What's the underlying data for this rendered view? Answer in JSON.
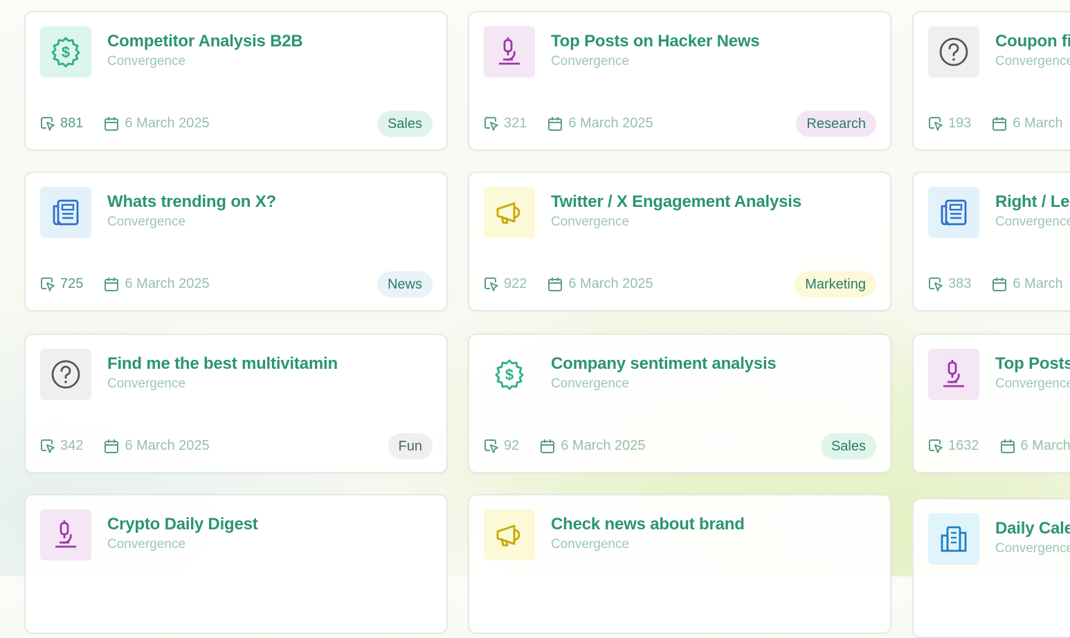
{
  "cards": [
    {
      "title": "Competitor Analysis B2B",
      "subtitle": "Convergence",
      "count": "881",
      "date": "6 March 2025",
      "tag": "Sales",
      "icon": "dollar-icon"
    },
    {
      "title": "Top Posts on Hacker News",
      "subtitle": "Convergence",
      "count": "321",
      "date": "6 March 2025",
      "tag": "Research",
      "icon": "microscope-icon"
    },
    {
      "title": "Coupon fi",
      "subtitle": "Convergence",
      "count": "193",
      "date": "6 March",
      "icon": "question-icon"
    },
    {
      "title": "Whats trending on X?",
      "subtitle": "Convergence",
      "count": "725",
      "date": "6 March 2025",
      "tag": "News",
      "icon": "newspaper-icon"
    },
    {
      "title": "Twitter / X Engagement Analysis",
      "subtitle": "Convergence",
      "count": "922",
      "date": "6 March 2025",
      "tag": "Marketing",
      "icon": "megaphone-icon"
    },
    {
      "title": "Right / Le",
      "subtitle": "Convergence",
      "count": "383",
      "date": "6 March",
      "icon": "newspaper-icon"
    },
    {
      "title": "Find me the best multivitamin",
      "subtitle": "Convergence",
      "count": "342",
      "date": "6 March 2025",
      "tag": "Fun",
      "icon": "question-icon"
    },
    {
      "title": "Company sentiment analysis",
      "subtitle": "Convergence",
      "count": "92",
      "date": "6 March 2025",
      "tag": "Sales",
      "icon": "dollar-icon"
    },
    {
      "title": "Top Posts",
      "subtitle": "Convergence",
      "count": "1632",
      "date": "6 March",
      "icon": "microscope-icon"
    },
    {
      "title": "Crypto Daily Digest",
      "subtitle": "Convergence",
      "icon": "microscope-icon"
    },
    {
      "title": "Check news about brand",
      "subtitle": "Convergence",
      "icon": "megaphone-icon"
    },
    {
      "title": "Daily Cale",
      "subtitle": "Convergence",
      "icon": "building-icon"
    }
  ],
  "colors": {
    "title": "#2b9474",
    "subtitle": "#9cc7b8",
    "sales_tag_bg": "#dff5ec",
    "research_tag_bg": "#f2e6f4",
    "news_tag_bg": "#e8f3f8",
    "marketing_tag_bg": "#fbf9d8",
    "fun_tag_bg": "#efefef"
  }
}
